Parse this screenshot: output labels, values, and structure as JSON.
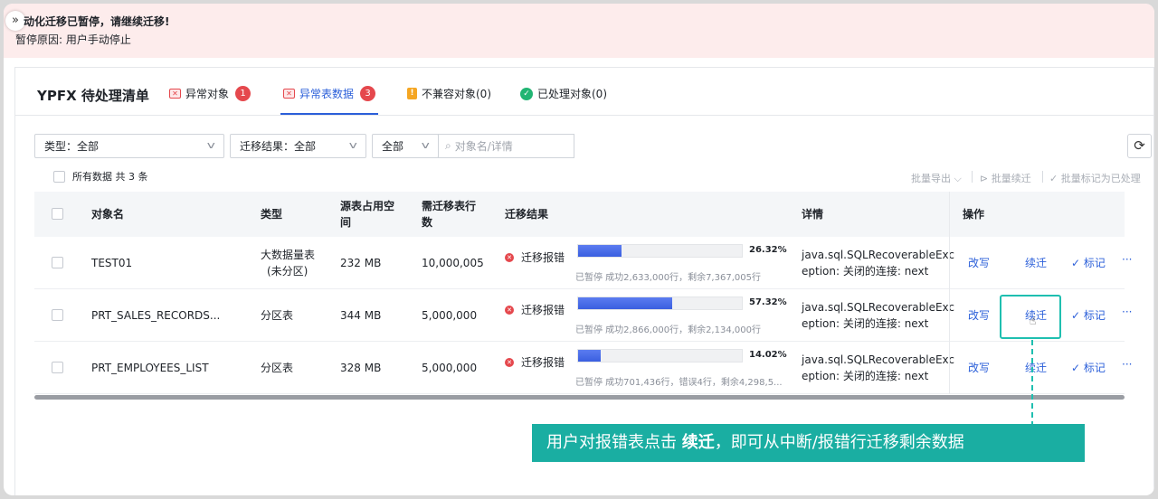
{
  "banner": {
    "title": "动化迁移已暂停，请继续迁移!",
    "reason": "暂停原因: 用户手动停止"
  },
  "panel": {
    "title": "YPFX 待处理清单"
  },
  "tabs": [
    {
      "label": "异常对象",
      "count": "1",
      "icon": "error-table-icon"
    },
    {
      "label": "异常表数据",
      "count": "3",
      "icon": "error-table-icon"
    },
    {
      "label": "不兼容对象(0)",
      "icon": "warning-icon"
    },
    {
      "label": "已处理对象(0)",
      "icon": "check-circle-icon"
    }
  ],
  "filters": {
    "type_label": "类型：",
    "type_value": "全部",
    "result_label": "迁移结果：",
    "result_value": "全部",
    "scope_value": "全部",
    "search_placeholder": "对象名/详情"
  },
  "summary": "所有数据 共 3 条",
  "batch_actions": {
    "export": "批量导出",
    "resume": "批量续迁",
    "mark": "批量标记为已处理"
  },
  "columns": {
    "name": "对象名",
    "type": "类型",
    "size": "源表占用空间",
    "rows": "需迁移表行数",
    "result": "迁移结果",
    "detail": "详情",
    "ops": "操作"
  },
  "rows": [
    {
      "name": "TEST01",
      "type_line1": "大数据量表",
      "type_line2": "(未分区)",
      "size": "232 MB",
      "rows": "10,000,005",
      "status": "迁移报错",
      "progress": 26.32,
      "progress_label": "26.32%",
      "sub": "已暂停 成功2,633,000行，剩余7,367,005行",
      "detail_line1": "java.sql.SQLRecoverableExc",
      "detail_line2": "eption: 关闭的连接: next"
    },
    {
      "name": "PRT_SALES_RECORDS...",
      "type_line1": "分区表",
      "type_line2": "",
      "size": "344 MB",
      "rows": "5,000,000",
      "status": "迁移报错",
      "progress": 57.32,
      "progress_label": "57.32%",
      "sub": "已暂停 成功2,866,000行，剩余2,134,000行",
      "detail_line1": "java.sql.SQLRecoverableExc",
      "detail_line2": "eption: 关闭的连接: next"
    },
    {
      "name": "PRT_EMPLOYEES_LIST",
      "type_line1": "分区表",
      "type_line2": "",
      "size": "328 MB",
      "rows": "5,000,000",
      "status": "迁移报错",
      "progress": 14.02,
      "progress_label": "14.02%",
      "sub": "已暂停 成功701,436行，错误4行，剩余4,298,5...",
      "detail_line1": "java.sql.SQLRecoverableExc",
      "detail_line2": "eption: 关闭的连接: next"
    }
  ],
  "row_actions": {
    "rewrite": "改写",
    "resume": "续迁",
    "mark": "标记",
    "more": "···"
  },
  "callout": {
    "prefix": "用户对报错表点击 ",
    "emphasis": "续迁",
    "suffix": "，即可从中断/报错行迁移剩余数据"
  },
  "colors": {
    "accent": "#2b5fd9",
    "error": "#e5484d",
    "callout": "#1aaea2"
  }
}
